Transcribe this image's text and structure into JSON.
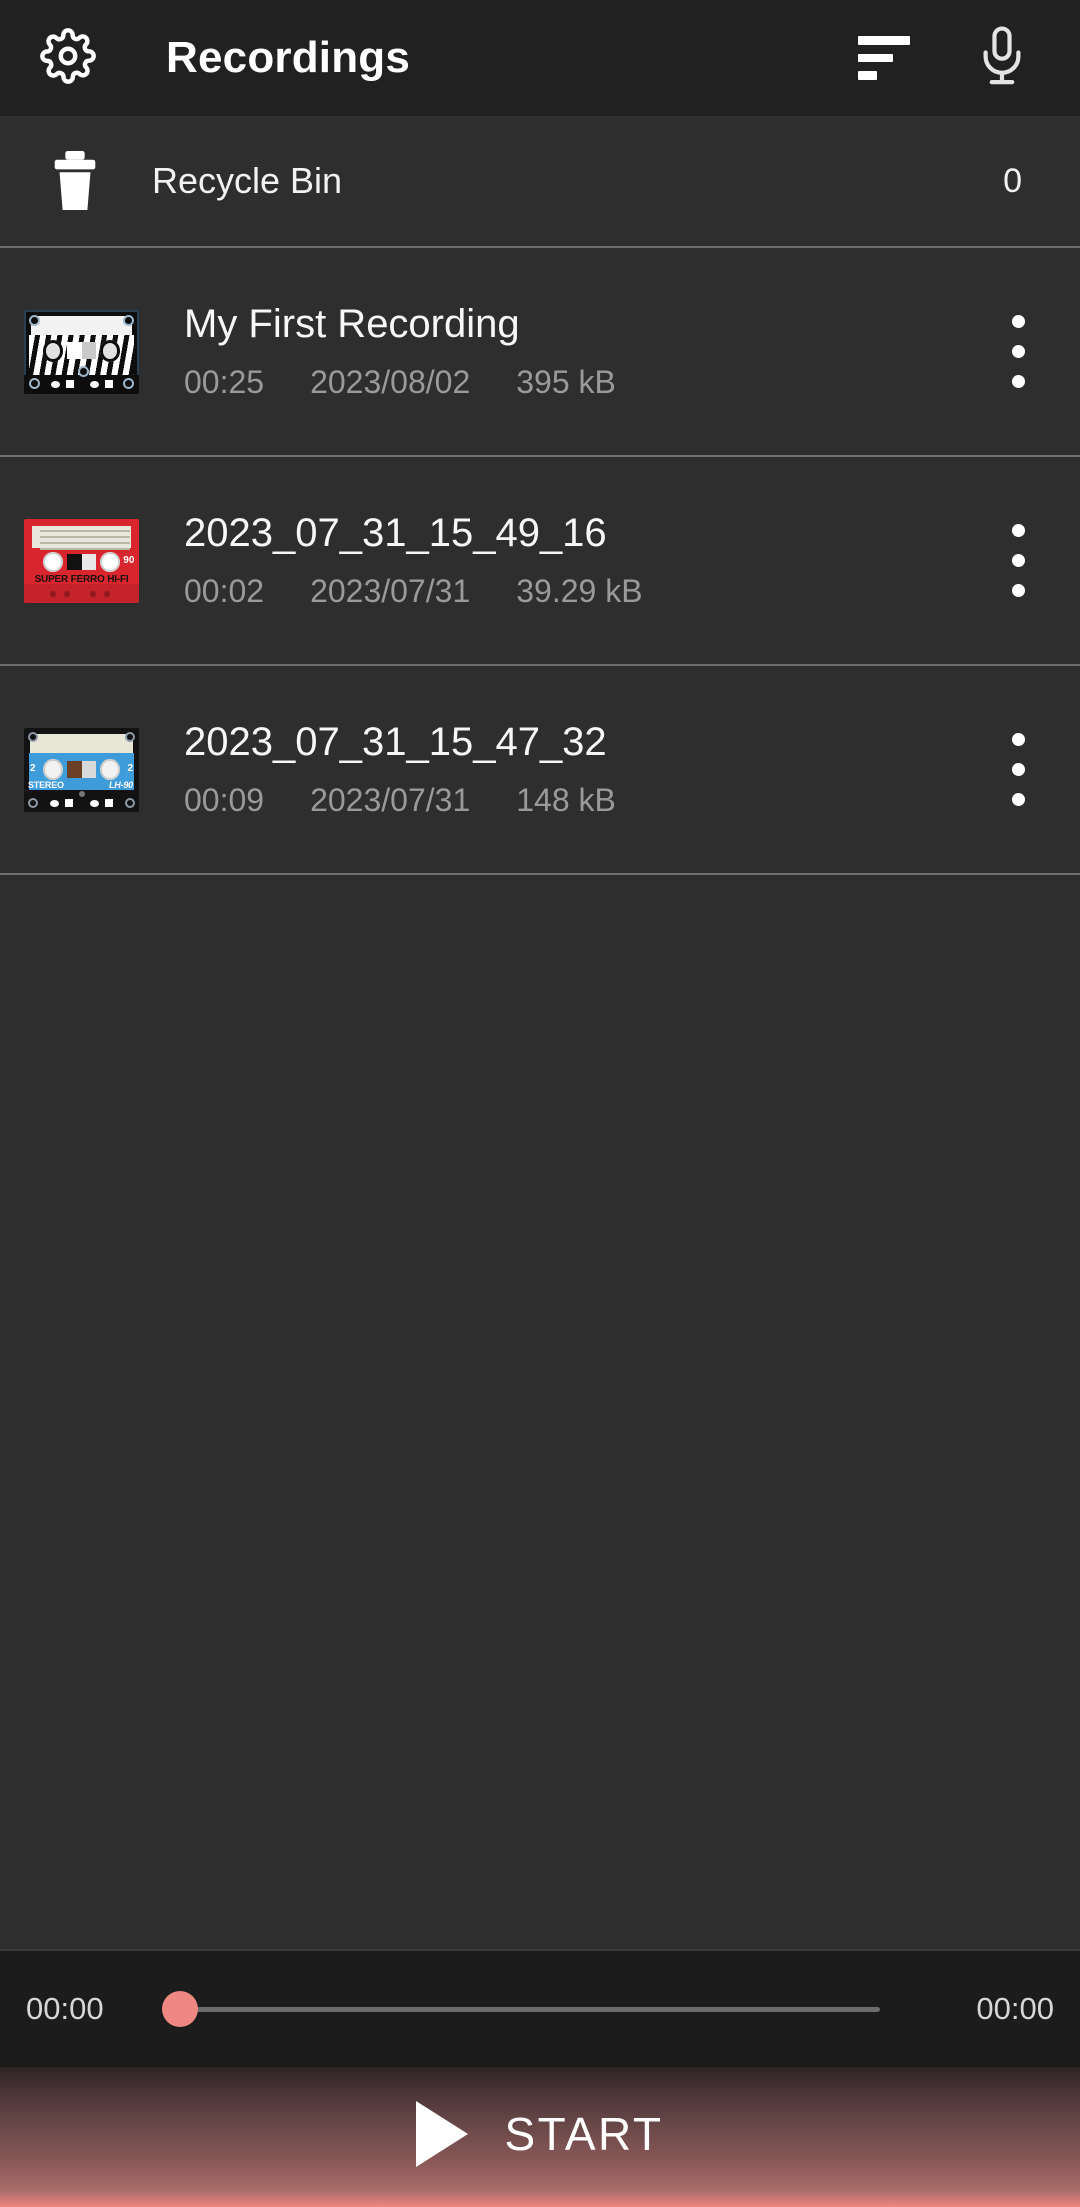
{
  "appbar": {
    "title": "Recordings",
    "settings_icon": "gear-icon",
    "sort_icon": "sort-icon",
    "record_icon": "microphone-icon"
  },
  "recycle_bin": {
    "icon": "trash-icon",
    "label": "Recycle Bin",
    "count": "0"
  },
  "recordings": [
    {
      "title": "My First Recording",
      "duration": "00:25",
      "date": "2023/08/02",
      "size": "395 kB",
      "thumbnail": "cassette-black-white",
      "menu_icon": "kebab-menu-icon"
    },
    {
      "title": "2023_07_31_15_49_16",
      "duration": "00:02",
      "date": "2023/07/31",
      "size": "39.29 kB",
      "thumbnail": "cassette-red",
      "thumb_brand": "SUPER FERRO HI-FI",
      "thumb_length": "90",
      "menu_icon": "kebab-menu-icon"
    },
    {
      "title": "2023_07_31_15_47_32",
      "duration": "00:09",
      "date": "2023/07/31",
      "size": "148 kB",
      "thumbnail": "cassette-blue",
      "thumb_brand": "STEREO",
      "thumb_type": "LH-90",
      "thumb_side": "2",
      "menu_icon": "kebab-menu-icon"
    }
  ],
  "player": {
    "elapsed": "00:00",
    "total": "00:00",
    "progress_percent": 0,
    "thumb_color": "#ef8782",
    "track_color": "#6d6d6d"
  },
  "start_button": {
    "label": "START",
    "icon": "play-icon",
    "accent_color": "#ef8782"
  },
  "theme": {
    "appbar_bg": "#212121",
    "content_bg": "#2e2e2e",
    "player_bg": "#1c1c1c",
    "divider": "#6e6e6e",
    "primary_text": "#f7f7f7",
    "secondary_text": "#9a9a9a"
  }
}
